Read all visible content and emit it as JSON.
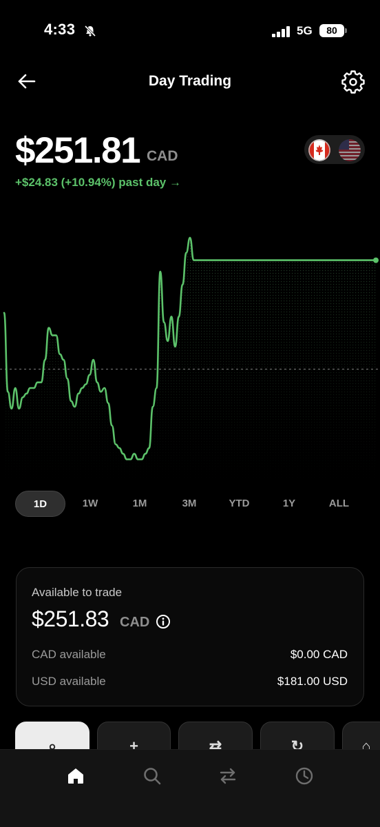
{
  "status_bar": {
    "time": "4:33",
    "network": "5G",
    "battery": "80"
  },
  "header": {
    "title": "Day Trading"
  },
  "balance": {
    "amount": "$251.81",
    "currency": "CAD",
    "change": "+$24.83 (+10.94%) past day →"
  },
  "currency_toggle": {
    "options": [
      "CAD",
      "USD"
    ],
    "selected": "CAD"
  },
  "colors": {
    "accent": "#5cc26a",
    "background": "#000000",
    "card": "#0a0a0a"
  },
  "chart_data": {
    "type": "line",
    "x": [
      0,
      1,
      2,
      3,
      4,
      5,
      6,
      7,
      8,
      9,
      10,
      11,
      12,
      13,
      14,
      15,
      16,
      17,
      18,
      19,
      20,
      21,
      22,
      23,
      24,
      25,
      26,
      27,
      28,
      29,
      30,
      31,
      32,
      33,
      34,
      35,
      36,
      37,
      38,
      39,
      40,
      41,
      42,
      43,
      44,
      45,
      46,
      47,
      48,
      49,
      50,
      51,
      52,
      53,
      54,
      55,
      56,
      57,
      58,
      59,
      60,
      61,
      62,
      63,
      64,
      65,
      66,
      67,
      68,
      69,
      70,
      71,
      72,
      73,
      74,
      75,
      76,
      77,
      78,
      79,
      80,
      81,
      82,
      83,
      84,
      85,
      86,
      87,
      88,
      89,
      90,
      91,
      92,
      93,
      94,
      95,
      96,
      97,
      98,
      99,
      100
    ],
    "values": [
      80,
      38,
      29,
      40,
      29,
      35,
      37,
      40,
      40,
      43,
      43,
      55,
      72,
      68,
      68,
      58,
      55,
      45,
      33,
      30,
      37,
      40,
      42,
      47,
      55,
      43,
      38,
      40,
      32,
      20,
      10,
      8,
      5,
      2,
      2,
      5,
      2,
      2,
      5,
      8,
      30,
      40,
      102,
      75,
      65,
      78,
      62,
      78,
      95,
      112,
      120,
      108,
      108,
      108,
      108,
      108,
      108,
      108,
      108,
      108,
      108,
      108,
      108,
      108,
      108,
      108,
      108,
      108,
      108,
      108,
      108,
      108,
      108,
      108,
      108,
      108,
      108,
      108,
      108,
      108,
      108,
      108,
      108,
      108,
      108,
      108,
      108,
      108,
      108,
      108,
      108,
      108,
      108,
      108,
      108,
      108,
      108,
      108,
      108,
      108,
      108
    ],
    "baseline": 50,
    "grid": false
  },
  "time_ranges": [
    "1D",
    "1W",
    "1M",
    "3M",
    "YTD",
    "1Y",
    "ALL"
  ],
  "selected_range": "1D",
  "available": {
    "label": "Available to trade",
    "amount": "$251.83",
    "currency": "CAD",
    "rows": [
      {
        "label": "CAD available",
        "value": "$0.00 CAD"
      },
      {
        "label": "USD available",
        "value": "$181.00 USD"
      }
    ]
  },
  "actions": [
    {
      "icon": "search-icon",
      "glyph": "⌕"
    },
    {
      "icon": "plus-icon",
      "glyph": "+"
    },
    {
      "icon": "transfer-icon",
      "glyph": "⇄"
    },
    {
      "icon": "refresh-icon",
      "glyph": "↻"
    },
    {
      "icon": "more-icon",
      "glyph": "⌂"
    }
  ],
  "bottom_nav": [
    {
      "name": "home",
      "icon": "home-icon"
    },
    {
      "name": "search",
      "icon": "search-icon"
    },
    {
      "name": "transfer",
      "icon": "transfer-icon"
    },
    {
      "name": "history",
      "icon": "clock-icon"
    }
  ]
}
